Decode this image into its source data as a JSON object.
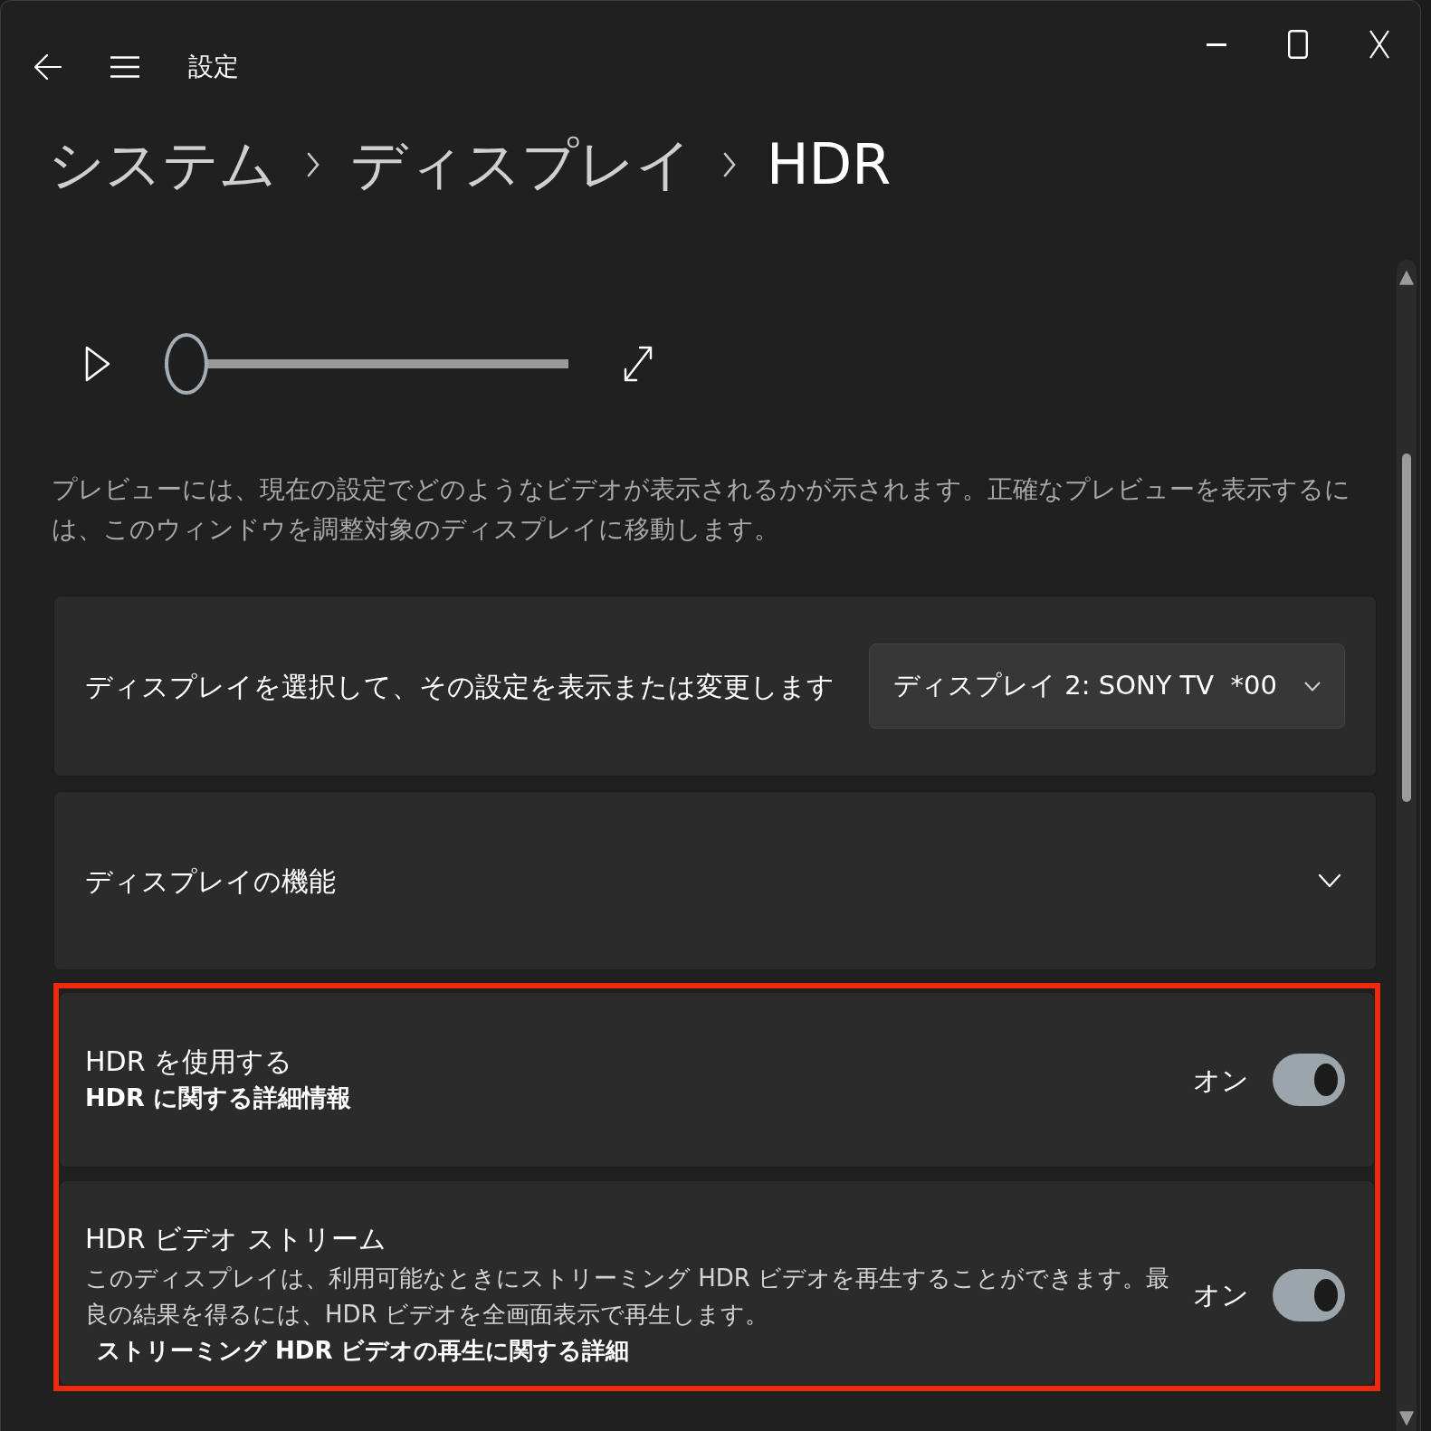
{
  "window": {
    "title": "設定"
  },
  "breadcrumb": [
    {
      "label": "システム",
      "current": false
    },
    {
      "label": "ディスプレイ",
      "current": false
    },
    {
      "label": "HDR",
      "current": true
    }
  ],
  "preview": {
    "playing": false,
    "slider": {
      "level": 0
    },
    "description": "プレビューには、現在の設定でどのようなビデオが表示されるかが示されます。正確なプレビューを表示するには、このウィンドウを調整対象のディスプレイに移動します。"
  },
  "display_select": {
    "label": "ディスプレイを選択して、その設定を表示または変更します",
    "value": "ディスプレイ 2: SONY TV  *00"
  },
  "display_features": {
    "label": "ディスプレイの機能",
    "expanded": false
  },
  "hdr_settings": {
    "highlighted": true,
    "items": [
      {
        "title": "HDR を使用する",
        "link": "HDR に関する詳細情報",
        "state_label": "オン",
        "on": true
      },
      {
        "title": "HDR ビデオ ストリーム",
        "description": "このディスプレイは、利用可能なときにストリーミング HDR ビデオを再生することができます。最良の結果を得るには、HDR ビデオを全画面表示で再生します。",
        "link": "ストリーミング HDR ビデオの再生に関する詳細",
        "state_label": "オン",
        "on": true
      }
    ]
  }
}
